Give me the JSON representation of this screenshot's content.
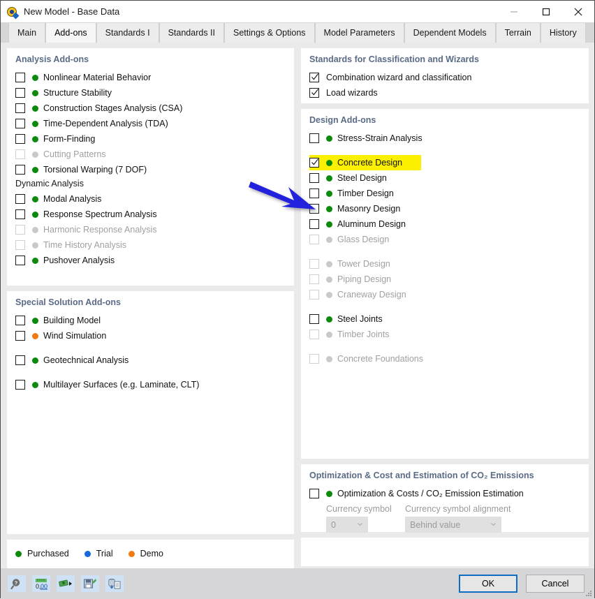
{
  "window": {
    "title": "New Model - Base Data",
    "icon": "app-logo-icon",
    "minimize": "minimize-icon",
    "maximize": "maximize-icon",
    "close": "close-icon"
  },
  "tabs": [
    {
      "label": "Main",
      "active": false
    },
    {
      "label": "Add-ons",
      "active": true
    },
    {
      "label": "Standards I",
      "active": false
    },
    {
      "label": "Standards II",
      "active": false
    },
    {
      "label": "Settings & Options",
      "active": false
    },
    {
      "label": "Model Parameters",
      "active": false
    },
    {
      "label": "Dependent Models",
      "active": false
    },
    {
      "label": "Terrain",
      "active": false
    },
    {
      "label": "History",
      "active": false
    }
  ],
  "left": {
    "analysis": {
      "title": "Analysis Add-ons",
      "items": [
        {
          "label": "Nonlinear Material Behavior",
          "checked": false,
          "status": "purchased",
          "disabled": false
        },
        {
          "label": "Structure Stability",
          "checked": false,
          "status": "purchased",
          "disabled": false
        },
        {
          "label": "Construction Stages Analysis (CSA)",
          "checked": false,
          "status": "purchased",
          "disabled": false
        },
        {
          "label": "Time-Dependent Analysis (TDA)",
          "checked": false,
          "status": "purchased",
          "disabled": false
        },
        {
          "label": "Form-Finding",
          "checked": false,
          "status": "purchased",
          "disabled": false
        },
        {
          "label": "Cutting Patterns",
          "checked": false,
          "status": "none",
          "disabled": true
        },
        {
          "label": "Torsional Warping (7 DOF)",
          "checked": false,
          "status": "purchased",
          "disabled": false
        }
      ],
      "subsection_title": "Dynamic Analysis",
      "dynamic_items": [
        {
          "label": "Modal Analysis",
          "checked": false,
          "status": "purchased",
          "disabled": false
        },
        {
          "label": "Response Spectrum Analysis",
          "checked": false,
          "status": "purchased",
          "disabled": false
        },
        {
          "label": "Harmonic Response Analysis",
          "checked": false,
          "status": "none",
          "disabled": true
        },
        {
          "label": "Time History Analysis",
          "checked": false,
          "status": "none",
          "disabled": true
        },
        {
          "label": "Pushover Analysis",
          "checked": false,
          "status": "purchased",
          "disabled": false
        }
      ]
    },
    "special": {
      "title": "Special Solution Add-ons",
      "items": [
        {
          "label": "Building Model",
          "checked": false,
          "status": "purchased",
          "disabled": false,
          "gap": false
        },
        {
          "label": "Wind Simulation",
          "checked": false,
          "status": "demo",
          "disabled": false,
          "gap": false
        },
        {
          "label": "Geotechnical Analysis",
          "checked": false,
          "status": "purchased",
          "disabled": false,
          "gap": true
        },
        {
          "label": "Multilayer Surfaces (e.g. Laminate, CLT)",
          "checked": false,
          "status": "purchased",
          "disabled": false,
          "gap": true
        }
      ]
    },
    "legend": {
      "entries": [
        {
          "label": "Purchased",
          "status": "purchased"
        },
        {
          "label": "Trial",
          "status": "trial"
        },
        {
          "label": "Demo",
          "status": "demo"
        }
      ]
    }
  },
  "right": {
    "standards": {
      "title": "Standards for Classification and Wizards",
      "items": [
        {
          "label": "Combination wizard and classification",
          "checked": true
        },
        {
          "label": "Load wizards",
          "checked": true
        }
      ]
    },
    "design": {
      "title": "Design Add-ons",
      "items": [
        {
          "label": "Stress-Strain Analysis",
          "checked": false,
          "status": "purchased",
          "disabled": false,
          "gap": false,
          "highlight": false
        },
        {
          "label": "Concrete Design",
          "checked": true,
          "status": "purchased",
          "disabled": false,
          "gap": true,
          "highlight": true
        },
        {
          "label": "Steel Design",
          "checked": false,
          "status": "purchased",
          "disabled": false,
          "gap": false,
          "highlight": false
        },
        {
          "label": "Timber Design",
          "checked": false,
          "status": "purchased",
          "disabled": false,
          "gap": false,
          "highlight": false
        },
        {
          "label": "Masonry Design",
          "checked": false,
          "status": "purchased",
          "disabled": false,
          "gap": false,
          "highlight": false
        },
        {
          "label": "Aluminum Design",
          "checked": false,
          "status": "purchased",
          "disabled": false,
          "gap": false,
          "highlight": false
        },
        {
          "label": "Glass Design",
          "checked": false,
          "status": "none",
          "disabled": true,
          "gap": false,
          "highlight": false
        },
        {
          "label": "Tower Design",
          "checked": false,
          "status": "none",
          "disabled": true,
          "gap": true,
          "highlight": false
        },
        {
          "label": "Piping Design",
          "checked": false,
          "status": "none",
          "disabled": true,
          "gap": false,
          "highlight": false
        },
        {
          "label": "Craneway Design",
          "checked": false,
          "status": "none",
          "disabled": true,
          "gap": false,
          "highlight": false
        },
        {
          "label": "Steel Joints",
          "checked": false,
          "status": "purchased",
          "disabled": false,
          "gap": true,
          "highlight": false
        },
        {
          "label": "Timber Joints",
          "checked": false,
          "status": "none",
          "disabled": true,
          "gap": false,
          "highlight": false
        },
        {
          "label": "Concrete Foundations",
          "checked": false,
          "status": "none",
          "disabled": true,
          "gap": true,
          "highlight": false
        }
      ]
    },
    "optimization": {
      "title": "Optimization & Cost and Estimation of CO₂ Emissions",
      "main_item": {
        "label": "Optimization & Costs / CO₂ Emission Estimation",
        "checked": false,
        "status": "purchased"
      },
      "currency_symbol_label": "Currency symbol",
      "currency_symbol_value": "0",
      "currency_alignment_label": "Currency symbol alignment",
      "currency_alignment_value": "Behind value"
    }
  },
  "toolbar": {
    "icons": [
      "help-search-icon",
      "units-decimal-icon",
      "money-transfer-icon",
      "save-template-icon",
      "import-data-icon"
    ]
  },
  "footer": {
    "ok_label": "OK",
    "cancel_label": "Cancel"
  },
  "annotation": {
    "arrow": "blue-arrow-pointer",
    "color": "#2222dd"
  },
  "colors": {
    "purchased": "#0b8a0b",
    "trial": "#1668dc",
    "demo": "#f07b12",
    "none": "#c9c9c9",
    "highlight": "#fbf000",
    "panel_title": "#5a6b86",
    "accent": "#0d6cc4"
  }
}
